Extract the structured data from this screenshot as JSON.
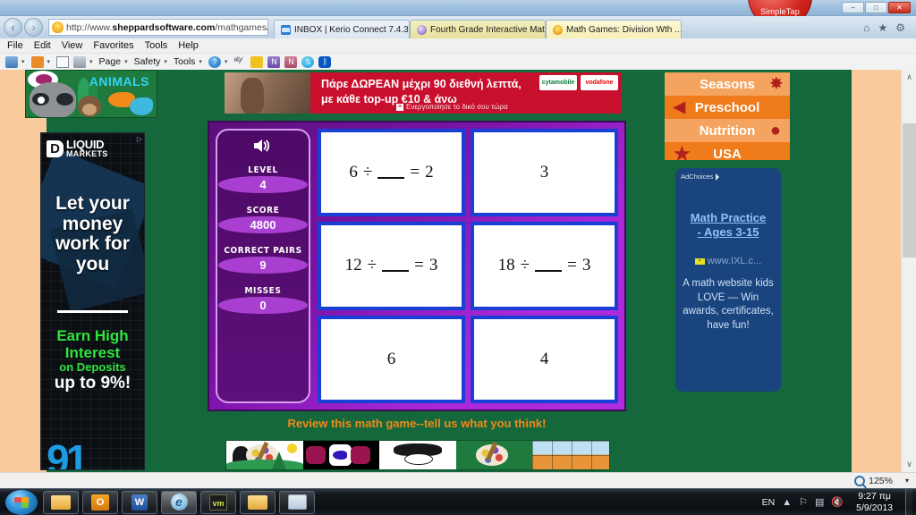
{
  "window": {
    "minimize": "–",
    "maximize": "□",
    "close": "✕",
    "simpletap_label": "SimpleTap"
  },
  "browser": {
    "back_icon": "‹",
    "forward_icon": "›",
    "url_prefix": "http://www.",
    "url_domain": "sheppardsoftware.com",
    "url_path": "/mathgames/m",
    "search_icon": "⌕",
    "dropdown_caret": "▾",
    "compat_icon": "▧",
    "refresh_icon": "↻",
    "tabs": [
      {
        "title": "INBOX | Kerio Connect 7.4.3 W...",
        "icon": "mail-icon",
        "active": false
      },
      {
        "title": "Fourth Grade Interactive Math ...",
        "icon": "globe-icon",
        "active": false
      },
      {
        "title": "Math Games: Division Wth ...",
        "icon": "bulb-icon",
        "active": true,
        "close": "✕"
      }
    ],
    "right_glyphs": [
      "⌂",
      "★",
      "⚙"
    ],
    "menus": [
      "File",
      "Edit",
      "View",
      "Favorites",
      "Tools",
      "Help"
    ],
    "command_bar": [
      "Page",
      "Safety",
      "Tools"
    ],
    "command_icons": [
      "home-icon",
      "feed-icon",
      "read-mail-icon",
      "print-icon",
      "help-icon",
      "spellcheck-icon",
      "note-icon",
      "onenote-icon",
      "nitro-icon",
      "skype-icon",
      "bluetooth-icon"
    ]
  },
  "ads": {
    "left_banner": {
      "brand_line1": "LIQUID",
      "brand_line2": "MARKETS",
      "brand_mark": "D",
      "adchoices": "▷",
      "headline": "Let your money work for you",
      "sub_green_1": "Earn High",
      "sub_green_2": "Interest",
      "sub_green_small": "on Deposits",
      "sub_white": "up to 9%!",
      "corner_number": "91"
    },
    "top_banner": {
      "line1": "Πάρε ΔΩΡΕΑΝ μέχρι 90 διεθνή λεπτά,",
      "line2": "με κάθε top-up €10 & άνω",
      "cta_badge": "≡",
      "cta": "Ενεργοποίησε το δικό σου τώρα",
      "logo_left": "cytamobile",
      "logo_right": "vodafone"
    },
    "ixl": {
      "adchoices": "AdChoices",
      "title_line1": "Math Practice",
      "title_line2": "- Ages 3-15",
      "url": "www.IXL.c...",
      "body": "A math website kids LOVE — Win awards, certificates, have fun!"
    }
  },
  "site_nav": {
    "animals_label": "ANIMALS",
    "items": [
      {
        "label": "Seasons",
        "style": "b",
        "deco": "✸"
      },
      {
        "label": "Preschool",
        "style": "a",
        "deco": "◀"
      },
      {
        "label": "Nutrition",
        "style": "b",
        "deco": "●"
      },
      {
        "label": "USA",
        "style": "a",
        "deco": "★"
      }
    ]
  },
  "game": {
    "sound_icon": "🔊",
    "stats": [
      {
        "label": "LEVEL",
        "value": "4"
      },
      {
        "label": "SCORE",
        "value": "4800"
      },
      {
        "label": "CORRECT PAIRS",
        "value": "9"
      },
      {
        "label": "MISSES",
        "value": "0"
      }
    ],
    "cards": [
      {
        "type": "equation",
        "left": "6",
        "op": "÷",
        "eq": "=",
        "right": "2"
      },
      {
        "type": "number",
        "text": "3"
      },
      {
        "type": "equation",
        "left": "12",
        "op": "÷",
        "eq": "=",
        "right": "3"
      },
      {
        "type": "equation",
        "left": "18",
        "op": "÷",
        "eq": "=",
        "right": "3"
      },
      {
        "type": "number",
        "text": "6"
      },
      {
        "type": "number",
        "text": "4"
      }
    ],
    "review_text": "Review this math game--tell us what you think!",
    "colors": {
      "panel_purple": "#7a13a8",
      "stats_purple": "#4d0a66",
      "card_border_blue": "#1a3fd4",
      "page_green": "#14683b",
      "review_orange": "#f08a1b"
    }
  },
  "status": {
    "zoom": "125%",
    "caret": "▾"
  },
  "taskbar": {
    "items": [
      "windows-explorer",
      "outlook",
      "word",
      "internet-explorer",
      "vlc",
      "folder",
      "pictures"
    ],
    "word_glyph": "W",
    "outlook_glyph": "O",
    "ie_glyph": "e",
    "vm_glyph": "vm",
    "language": "EN",
    "tray_caret": "▲",
    "tray_icons": [
      "network-icon",
      "battery-icon",
      "volume-muted-icon"
    ],
    "time": "9:27 πμ",
    "date": "5/9/2013"
  }
}
